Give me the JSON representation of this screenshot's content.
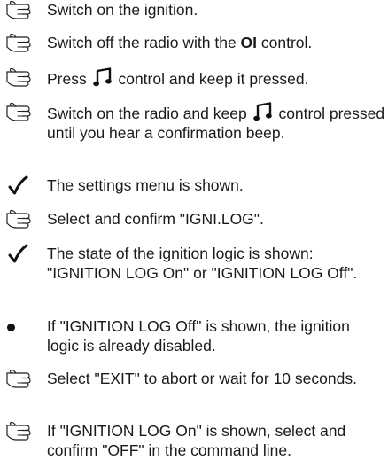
{
  "steps": [
    {
      "type": "action",
      "text": "Switch on the ignition."
    },
    {
      "type": "action",
      "pre": "Switch off the radio with the ",
      "bold": "OI",
      "post": " control."
    },
    {
      "type": "action",
      "pre": "Press ",
      "icon": "music-note-icon",
      "post": " control and keep it pressed."
    },
    {
      "type": "action",
      "line1_pre": "Switch on the radio and keep ",
      "icon": "music-note-icon",
      "line1_post": " control",
      "rest": "pressed until you hear a confirmation beep."
    },
    {
      "type": "result",
      "text": "The settings menu is shown."
    },
    {
      "type": "action",
      "text": "Select and confirm \"IGNI.LOG\"."
    },
    {
      "type": "result",
      "text": "The state of the ignition logic is shown: \"IGNITION LOG On\" or \"IGNITION LOG Off\"."
    },
    {
      "type": "bullet",
      "text": "If \"IGNITION LOG Off\" is shown, the ignition logic is already disabled."
    },
    {
      "type": "action",
      "text": "Select \"EXIT\" to abort or wait for 10 seconds."
    },
    {
      "type": "action",
      "text": "If \"IGNITION LOG On\" is shown, select and confirm \"OFF\" in the command line."
    }
  ],
  "icons": {
    "action": "pointing-hand-icon",
    "result": "checkmark-icon",
    "bullet": "bullet-dot-icon"
  }
}
